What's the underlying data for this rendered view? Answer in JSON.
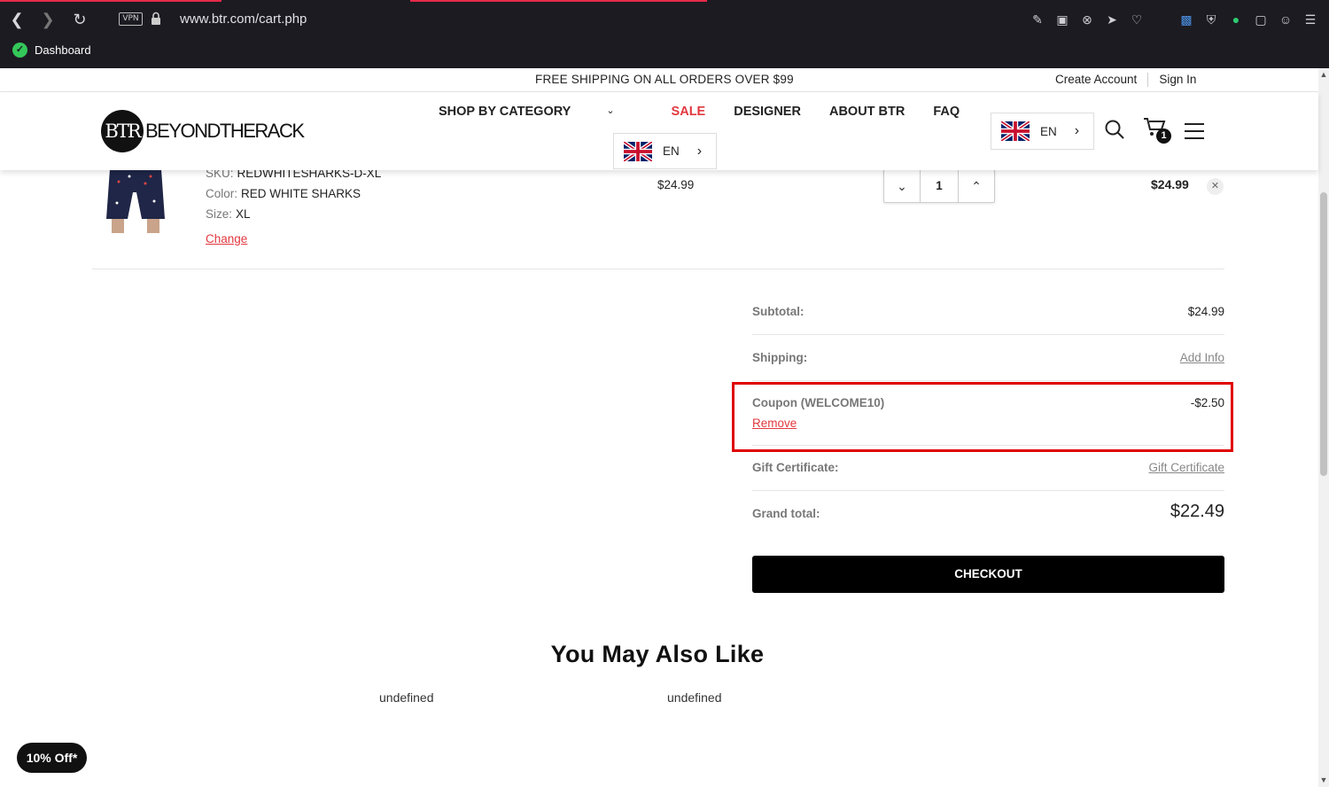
{
  "browser": {
    "url": "www.btr.com/cart.php",
    "vpn_label": "VPN",
    "bookmark_label": "Dashboard"
  },
  "promo": {
    "text": "FREE SHIPPING ON ALL ORDERS OVER $99",
    "create_account": "Create Account",
    "sign_in": "Sign In"
  },
  "header": {
    "logo_mark": "BTR",
    "logo_word": "BEYONDTHERACK",
    "nav": [
      "SHOP BY CATEGORY",
      "SALE",
      "DESIGNER",
      "ABOUT BTR",
      "FAQ"
    ],
    "lang_code": "EN",
    "cart_count": "1"
  },
  "item": {
    "sku_label": "SKU:",
    "sku": "REDWHITESHARKS-D-XL",
    "color_label": "Color:",
    "color": "RED WHITE SHARKS",
    "size_label": "Size:",
    "size": "XL",
    "change": "Change",
    "unit_price": "$24.99",
    "qty": "1",
    "line_total": "$24.99"
  },
  "summary": {
    "subtotal_label": "Subtotal:",
    "subtotal": "$24.99",
    "shipping_label": "Shipping:",
    "shipping_link": "Add Info",
    "coupon_label": "Coupon (WELCOME10)",
    "coupon_value": "-$2.50",
    "coupon_remove": "Remove",
    "gift_label": "Gift Certificate:",
    "gift_link": "Gift Certificate",
    "grand_label": "Grand total:",
    "grand_total": "$22.49",
    "checkout": "CHECKOUT"
  },
  "recommendations": {
    "title": "You May Also Like",
    "items": [
      "undefined",
      "undefined"
    ]
  },
  "floating_promo": "10% Off*",
  "colors": {
    "accent_red": "#e2383f",
    "highlight_red": "#e00000",
    "browser_dark": "#1c1b22"
  }
}
